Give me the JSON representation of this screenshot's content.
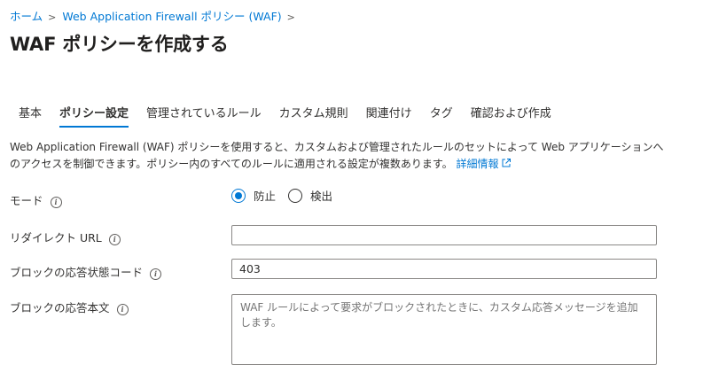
{
  "breadcrumb": {
    "home": "ホーム",
    "waf_policy": "Web Application Firewall ポリシー (WAF)"
  },
  "page": {
    "title": "WAF ポリシーを作成する"
  },
  "tabs": [
    {
      "label": "基本"
    },
    {
      "label": "ポリシー設定"
    },
    {
      "label": "管理されているルール"
    },
    {
      "label": "カスタム規則"
    },
    {
      "label": "関連付け"
    },
    {
      "label": "タグ"
    },
    {
      "label": "確認および作成"
    }
  ],
  "description": {
    "text": "Web Application Firewall (WAF) ポリシーを使用すると、カスタムおよび管理されたルールのセットによって Web アプリケーションへのアクセスを制御できます。ポリシー内のすべてのルールに適用される設定が複数あります。",
    "link": "詳細情報"
  },
  "form": {
    "mode": {
      "label": "モード",
      "options": [
        "防止",
        "検出"
      ],
      "selected": "防止"
    },
    "redirect_url": {
      "label": "リダイレクト URL",
      "value": ""
    },
    "block_status_code": {
      "label": "ブロックの応答状態コード",
      "value": "403"
    },
    "block_body": {
      "label": "ブロックの応答本文",
      "placeholder": "WAF ルールによって要求がブロックされたときに、カスタム応答メッセージを追加します。"
    }
  },
  "icons": {
    "info": "info-icon",
    "external_link": "external-link-icon",
    "chevron": "chevron-right-icon"
  },
  "colors": {
    "accent": "#0078d4",
    "text": "#323130",
    "border": "#8a8886"
  }
}
